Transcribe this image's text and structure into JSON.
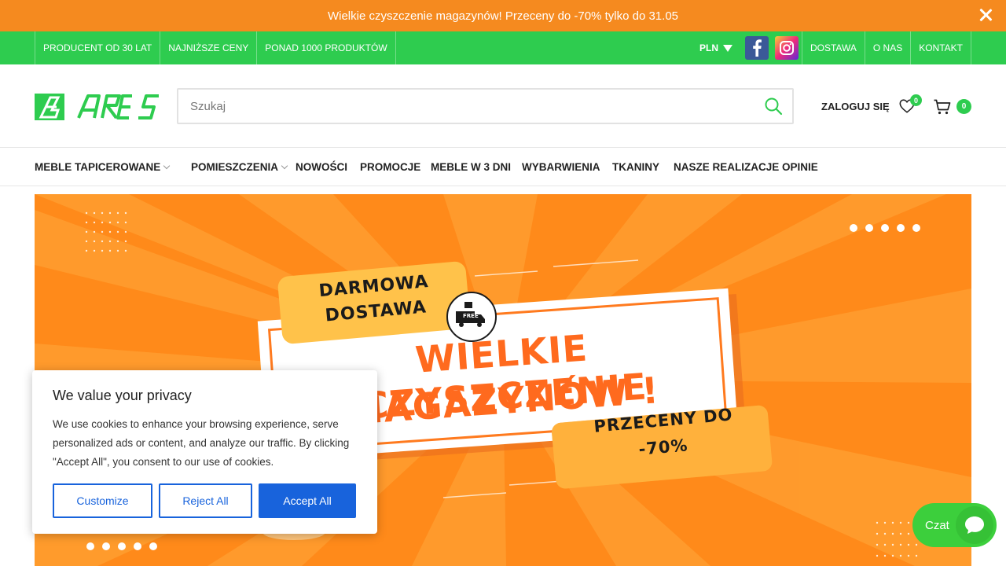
{
  "promo": {
    "text": "Wielkie czyszczenie magazynów! Przeceny do -70% tylko do 31.05"
  },
  "topbar": {
    "left_items": [
      "PRODUCENT OD 30 LAT",
      "NAJNIŻSZE CENY",
      "PONAD 1000 PRODUKTÓW"
    ],
    "currency": "PLN",
    "social": [
      "facebook-icon",
      "instagram-icon"
    ],
    "right_links": [
      "DOSTAWA",
      "O NAS",
      "KONTAKT"
    ]
  },
  "header": {
    "search_placeholder": "Szukaj",
    "login_label": "ZALOGUJ SIĘ",
    "wishlist_count": "0",
    "cart_count": "0"
  },
  "nav": {
    "items": [
      "MEBLE TAPICEROWANE",
      "POMIESZCZENIA",
      "NOWOŚCI",
      "PROMOCJE",
      "MEBLE W 3 DNI",
      "WYBARWIENIA",
      "TKANINY",
      "NASZE REALIZACJE",
      "OPINIE"
    ]
  },
  "hero": {
    "tag1": "DARMOWA DOSTAWA",
    "truck_label": "FREE",
    "title_line1": "WIELKIE CZYSZCZENIE",
    "title_line2": "MAGAZYNÓW !",
    "tag2_line1": "PRZECENY DO",
    "tag2_line2": "-70%",
    "colors": {
      "background": "#ff8a1a",
      "accent": "#ff6a1e",
      "tag": "#ffc24a"
    }
  },
  "cookie": {
    "title": "We value your privacy",
    "body": "We use cookies to enhance your browsing experience, serve personalized ads or content, and analyze our traffic. By clicking \"Accept All\", you consent to our use of cookies.",
    "customize": "Customize",
    "reject": "Reject All",
    "accept": "Accept All"
  },
  "chat": {
    "label": "Czat"
  },
  "colors": {
    "green": "#2ecc4f",
    "orange": "#f58a1f",
    "blue": "#1863dc"
  }
}
